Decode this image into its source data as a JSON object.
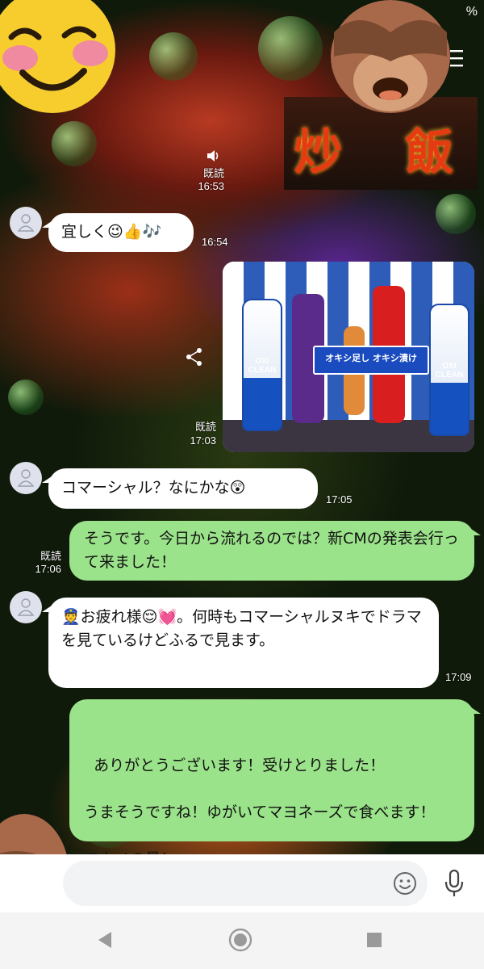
{
  "status_bar": {
    "battery_percent": "%"
  },
  "header": {
    "title_sticker_chars": [
      "炒",
      "飯"
    ],
    "menu_icon": "hamburger-icon"
  },
  "messages": [
    {
      "id": 1,
      "side": "out",
      "type": "voice-ts",
      "read": "既読",
      "time": "16:53"
    },
    {
      "id": 2,
      "side": "in",
      "type": "text",
      "text": "宜しく😉👍🎶",
      "time": "16:54"
    },
    {
      "id": 3,
      "side": "out",
      "type": "image",
      "read": "既読",
      "time": "17:03",
      "photo": {
        "banner": "オキシ足し オキシ漬け",
        "bottle_label": "OXI CLEAN"
      }
    },
    {
      "id": 4,
      "side": "in",
      "type": "text",
      "text": "コマーシャル？なにかな😲",
      "time": "17:05"
    },
    {
      "id": 5,
      "side": "out",
      "type": "text",
      "read": "既読",
      "time": "17:06",
      "text": "そうです。今日から流れるのでは？新CMの発表会行って来ました！"
    },
    {
      "id": 6,
      "side": "in",
      "type": "text",
      "time": "17:09",
      "text": "👮お疲れ様😌💓。何時もコマーシャルヌキでドラマを見ているけどふるで見ます。"
    },
    {
      "id": 7,
      "side": "out",
      "type": "text",
      "text": "ありがとうございます！受けとりました！\n\nうまそうですね！ゆがいてマヨネーズで食べます！\n\nワカメの量！"
    }
  ],
  "input": {
    "placeholder": "",
    "value": "",
    "emoji_icon": "smiley-icon",
    "mic_icon": "microphone-icon"
  },
  "nav": {
    "back": "back-triangle-icon",
    "home": "home-circle-icon",
    "recents": "recents-square-icon"
  },
  "colors": {
    "bubble_in": "#ffffff",
    "bubble_out": "#9be38a",
    "ts_text": "#ffffff"
  }
}
